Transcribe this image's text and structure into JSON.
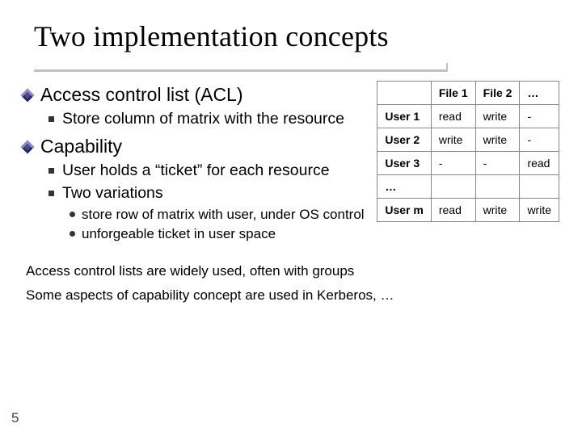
{
  "title": "Two implementation concepts",
  "bullets": {
    "acl_heading": "Access control list (ACL)",
    "acl_sub": "Store column of matrix with the resource",
    "cap_heading": "Capability",
    "cap_sub1": "User holds a “ticket” for each resource",
    "cap_sub2": "Two variations",
    "cap_sub2_a": "store row of matrix with user, under OS control",
    "cap_sub2_b": "unforgeable ticket in user space"
  },
  "table": {
    "headers": [
      "",
      "File 1",
      "File 2",
      "…"
    ],
    "rows": [
      [
        "User 1",
        "read",
        "write",
        "-"
      ],
      [
        "User 2",
        "write",
        "write",
        "-"
      ],
      [
        "User 3",
        "-",
        "-",
        "read"
      ],
      [
        "…",
        "",
        "",
        ""
      ],
      [
        "User m",
        "read",
        "write",
        "write"
      ]
    ]
  },
  "footer": {
    "line1": "Access control lists are widely used, often with groups",
    "line2": "Some aspects of capability concept are used in Kerberos, …"
  },
  "page_number": "5"
}
